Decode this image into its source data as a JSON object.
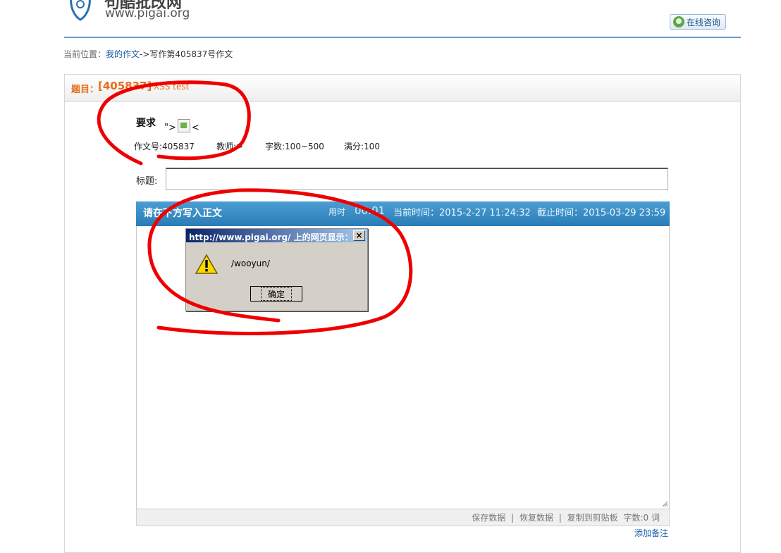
{
  "header": {
    "logo_text_cn": "句酷批改网",
    "logo_url": "www.pigai.org",
    "online_button_label": "在线咨询"
  },
  "breadcrumb": {
    "prefix": "当前位置：",
    "link": "我的作文",
    "separator": "->",
    "current": "写作第405837号作文"
  },
  "essay": {
    "title_label": "题目：",
    "id_bracket": "[405837]",
    "title_text": "XSS test",
    "req_label": "要求",
    "req_value_prefix": "\">",
    "req_value_suffix": "<",
    "meta": {
      "essay_no": "作文号:405837",
      "teacher": "教师:>",
      "word_count": "字数:100~500",
      "full_score": "满分:100"
    },
    "title_field_label": "标题:"
  },
  "editor": {
    "header": "请在下方写入正文",
    "used_label": "用时",
    "used_time": "00:01",
    "current_time": "当前时间：2015-2-27 11:24:32",
    "deadline": "截止时间：2015-03-29 23:59",
    "footer": {
      "save": "保存数据",
      "restore": "恢复数据",
      "copy": "复制到剪贴板",
      "sep": "|",
      "count": "字数:0 词"
    },
    "add_note": "添加备注"
  },
  "dialog": {
    "title": "http://www.pigai.org/ 上的网页显示：",
    "close": "×",
    "message": "/wooyun/",
    "ok_label": "确定"
  },
  "colors": {
    "annotation_red": "#ee0000",
    "accent_orange": "#e86d1a",
    "editor_blue": "#2a7cb7",
    "link_blue": "#1a5aa8"
  }
}
